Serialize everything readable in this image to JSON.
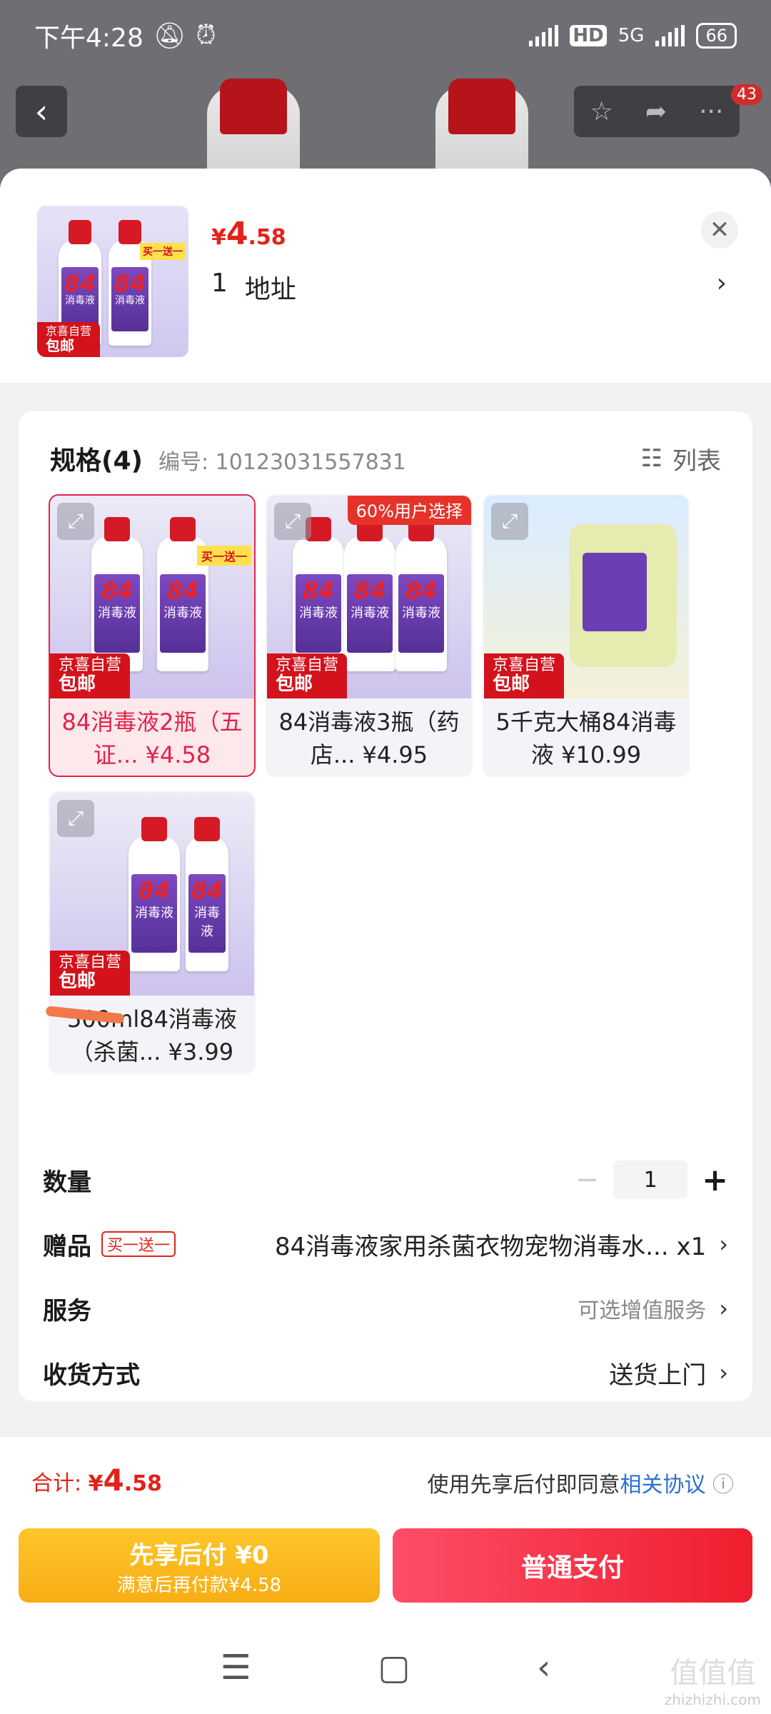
{
  "status_bar": {
    "time": "下午4:28",
    "network": "5G",
    "hd": "HD",
    "battery": "66"
  },
  "top_bar": {
    "badge_count": "43"
  },
  "header": {
    "currency": "¥",
    "price_int": "4",
    "price_dec": ".58",
    "address_count": "1",
    "address_label": "地址",
    "thumb_badge": "买一送一",
    "thumb_tag_line1": "京喜自营",
    "thumb_tag_line2": "包邮"
  },
  "spec": {
    "title": "规格(4)",
    "code": "编号: 10123031557831",
    "list_label": "列表",
    "options": [
      {
        "line1": "84消毒液2瓶（五",
        "line2": "证... ¥4.58",
        "tag1": "京喜自营",
        "tag2": "包邮",
        "selected": true
      },
      {
        "line1": "84消毒液3瓶（药",
        "line2": "店... ¥4.95",
        "tag1": "京喜自营",
        "tag2": "包邮",
        "hot": "60%用户选择"
      },
      {
        "line1": "5千克大桶84消毒",
        "line2": "液 ¥10.99",
        "tag1": "京喜自营",
        "tag2": "包邮"
      },
      {
        "line1": "500ml84消毒液",
        "line2": "（杀菌... ¥3.99",
        "tag1": "京喜自营",
        "tag2": "包邮"
      }
    ]
  },
  "rows": {
    "quantity_label": "数量",
    "quantity_value": "1",
    "gift_label": "赠品",
    "gift_badge": "买一送一",
    "gift_value": "84消毒液家用杀菌衣物宠物消毒水... x1",
    "service_label": "服务",
    "service_value": "可选增值服务",
    "delivery_label": "收货方式",
    "delivery_value": "送货上门"
  },
  "footer": {
    "total_label": "合计:",
    "total_currency": "¥",
    "total_int": "4",
    "total_dec": ".58",
    "agree_text": "使用先享后付即同意",
    "agree_link": "相关协议",
    "btn_later_line1": "先享后付 ¥0",
    "btn_later_line2": "满意后再付款¥4.58",
    "btn_pay": "普通支付"
  },
  "watermark": {
    "line1": "值值值",
    "line2": "zhizhizhi.com"
  },
  "colors": {
    "accent_red": "#e2231a",
    "pay_yellow": "#fdc62a",
    "link_blue": "#2a6fd6"
  }
}
